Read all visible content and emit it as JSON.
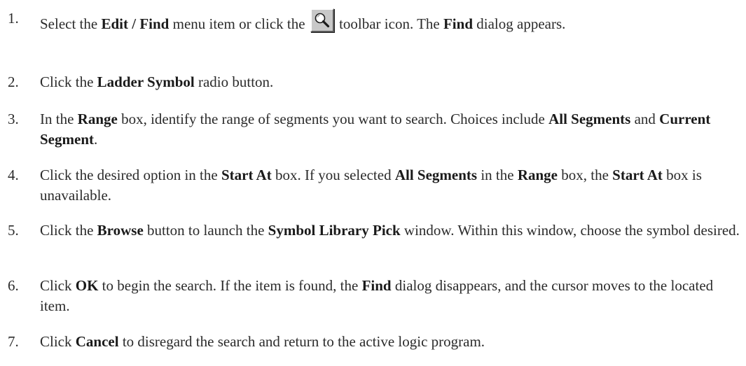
{
  "steps": [
    {
      "number": "1.",
      "parts": [
        {
          "t": "Select the "
        },
        {
          "b": "Edit"
        },
        {
          "sep": " / "
        },
        {
          "b": "Find"
        },
        {
          "t": " menu item or click the "
        },
        {
          "icon": "find-toolbar-icon"
        },
        {
          "t": " toolbar icon. The "
        },
        {
          "b": "Find"
        },
        {
          "t": " dialog appears."
        }
      ]
    },
    {
      "number": "2.",
      "parts": [
        {
          "t": "Click the "
        },
        {
          "b": "Ladder Symbol"
        },
        {
          "t": " radio button."
        }
      ]
    },
    {
      "number": "3.",
      "parts": [
        {
          "t": "In the "
        },
        {
          "b": "Range"
        },
        {
          "t": " box, identify the range of segments you want to search. Choices include "
        },
        {
          "b": "All Segments"
        },
        {
          "t": " and "
        },
        {
          "b": "Current Segment"
        },
        {
          "t": "."
        }
      ]
    },
    {
      "number": "4.",
      "parts": [
        {
          "t": "Click the desired option in the "
        },
        {
          "b": "Start At"
        },
        {
          "t": " box. If you selected "
        },
        {
          "b": "All Segments"
        },
        {
          "t": " in the "
        },
        {
          "b": "Range"
        },
        {
          "t": " box, the "
        },
        {
          "b": "Start At"
        },
        {
          "t": " box is unavailable."
        }
      ]
    },
    {
      "number": "5.",
      "parts": [
        {
          "t": "Click the "
        },
        {
          "b": "Browse"
        },
        {
          "t": " button to launch the "
        },
        {
          "b": "Symbol Library Pick"
        },
        {
          "t": " window. Within this window, choose the symbol desired."
        }
      ]
    },
    {
      "number": "6.",
      "parts": [
        {
          "t": "Click "
        },
        {
          "b": "OK"
        },
        {
          "t": " to begin the search. If the item is found, the "
        },
        {
          "b": "Find"
        },
        {
          "t": " dialog disappears, and the cursor moves to the located item."
        }
      ]
    },
    {
      "number": "7.",
      "parts": [
        {
          "t": "Click "
        },
        {
          "b": "Cancel"
        },
        {
          "t": " to disregard the search and return to the active logic program."
        }
      ]
    }
  ]
}
